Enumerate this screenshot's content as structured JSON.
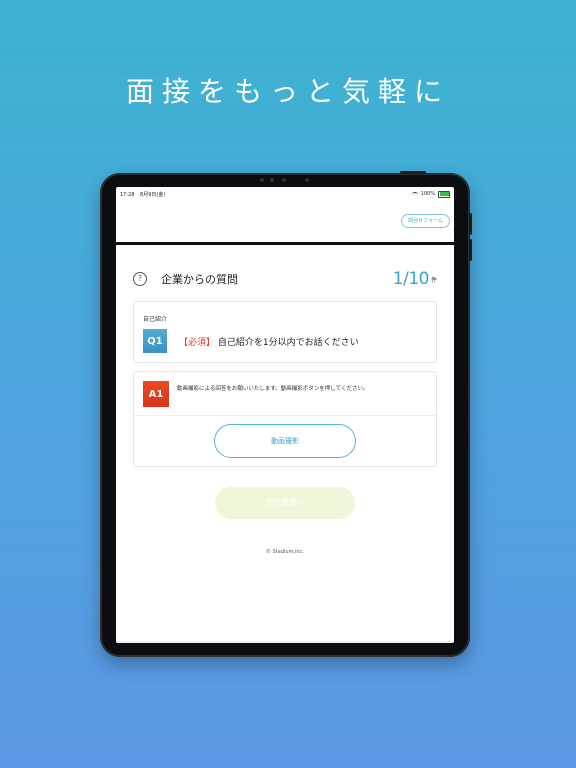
{
  "promo": {
    "headline": "面接をもっと気軽に"
  },
  "status_bar": {
    "time": "17:28",
    "date": "8月9日(金)",
    "battery": "100%"
  },
  "header": {
    "contact_button": "問合せフォーム"
  },
  "question_section": {
    "title": "企業からの質問",
    "counter": "1/10",
    "counter_unit": "件"
  },
  "question_card": {
    "label": "自己紹介",
    "badge": "Q1",
    "required": "【必須】",
    "text": "自己紹介を1分以内でお話ください"
  },
  "answer_card": {
    "badge": "A1",
    "instruction": "動画撮影による回答をお願いいたします。動画撮影ボタンを押してください。",
    "record_button": "動画撮影"
  },
  "next_button": "次の質問へ",
  "footer": {
    "copyright": "© Stadium,inc."
  },
  "colors": {
    "accent": "#3aa3c4",
    "required_red": "#d83a2e",
    "answer_badge": "#e84c24",
    "next_button_bg": "#eef7d8"
  }
}
